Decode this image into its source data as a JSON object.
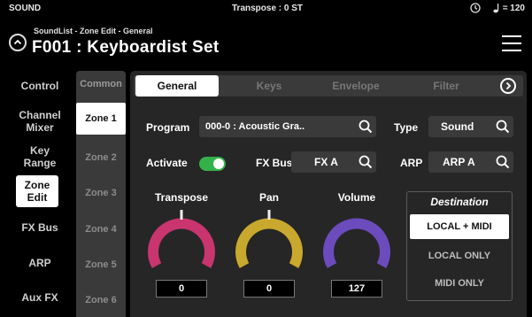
{
  "status": {
    "left": "SOUND",
    "center": "Transpose : 0 ST",
    "tempo": "= 120",
    "icons": [
      "metronome-icon",
      "quarter-note-icon"
    ]
  },
  "header": {
    "breadcrumb": "SoundList - Zone Edit - General",
    "title": "F001 : Keyboardist Set"
  },
  "sidebar": {
    "items": [
      {
        "label": "Control"
      },
      {
        "label": "Channel Mixer"
      },
      {
        "label": "Key Range"
      },
      {
        "label": "Zone Edit"
      },
      {
        "label": "FX Bus"
      },
      {
        "label": "ARP"
      },
      {
        "label": "Aux FX"
      }
    ],
    "active": "Zone Edit"
  },
  "zones": {
    "header": "Common",
    "items": [
      "Zone 1",
      "Zone 2",
      "Zone 3",
      "Zone 4",
      "Zone 5",
      "Zone 6"
    ],
    "active": "Zone 1"
  },
  "tabs": {
    "items": [
      "General",
      "Keys",
      "Envelope",
      "Filter"
    ],
    "active": "General"
  },
  "form": {
    "program_label": "Program",
    "program_value": "000-0 : Acoustic Gra..",
    "type_label": "Type",
    "type_value": "Sound",
    "activate_label": "Activate",
    "activate_on": true,
    "fxbus_label": "FX Bus",
    "fxbus_value": "FX A",
    "arp_label": "ARP",
    "arp_value": "ARP A"
  },
  "knobs": {
    "transpose": {
      "label": "Transpose",
      "value": "0",
      "color": "#c8356f"
    },
    "pan": {
      "label": "Pan",
      "value": "0",
      "color": "#c9a82e"
    },
    "volume": {
      "label": "Volume",
      "value": "127",
      "color": "#6c4bbd"
    }
  },
  "destination": {
    "title": "Destination",
    "options": [
      "LOCAL + MIDI",
      "LOCAL ONLY",
      "MIDI ONLY"
    ],
    "selected": "LOCAL + MIDI"
  }
}
